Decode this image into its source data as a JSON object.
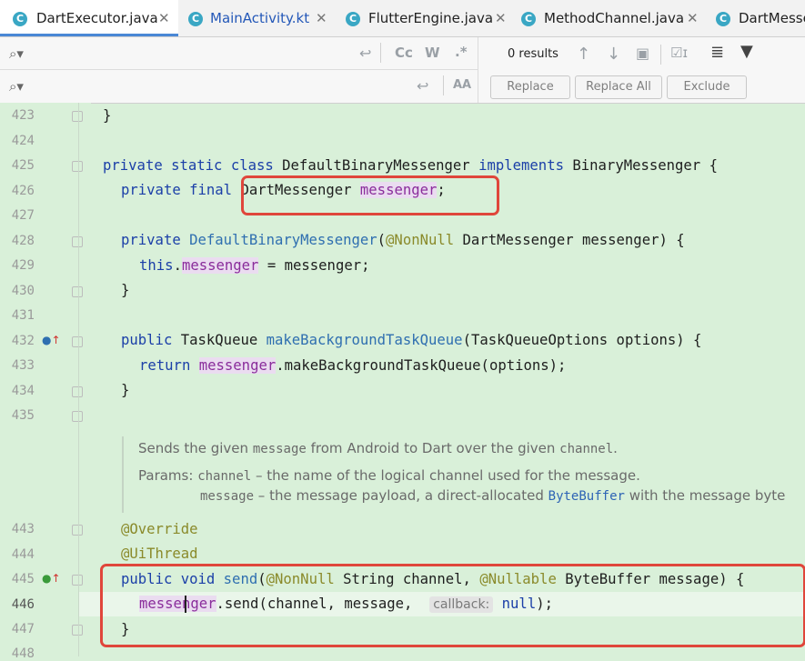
{
  "tabs": [
    {
      "label": "DartExecutor.java",
      "icon": "C",
      "active": true
    },
    {
      "label": "MainActivity.kt",
      "icon": "C",
      "active": false
    },
    {
      "label": "FlutterEngine.java",
      "icon": "C",
      "active": false
    },
    {
      "label": "MethodChannel.java",
      "icon": "C",
      "active": false
    },
    {
      "label": "DartMesse",
      "icon": "C",
      "active": false
    }
  ],
  "find": {
    "results": "0 results",
    "match_case": "Cc",
    "words": "W",
    "regex": ".*",
    "preserve_case": "AA",
    "replace": "Replace",
    "replace_all": "Replace All",
    "exclude": "Exclude"
  },
  "lines": {
    "n423": "423",
    "n424": "424",
    "n425": "425",
    "n426": "426",
    "n427": "427",
    "n428": "428",
    "n429": "429",
    "n430": "430",
    "n431": "431",
    "n432": "432",
    "n433": "433",
    "n434": "434",
    "n435": "435",
    "n443": "443",
    "n444": "444",
    "n445": "445",
    "n446": "446",
    "n447": "447",
    "n448": "448"
  },
  "code": {
    "l423": "}",
    "l425_kw": "private static class",
    "l425_name": "DefaultBinaryMessenger",
    "l425_impl": "implements",
    "l425_iface": "BinaryMessenger {",
    "l426_kw": "private final",
    "l426_type": "DartMessenger",
    "l426_field": "messenger",
    "l426_end": ";",
    "l428_kw": "private",
    "l428_fn": "DefaultBinaryMessenger",
    "l428_paren": "(",
    "l428_ann": "@NonNull",
    "l428_rest": "DartMessenger messenger) {",
    "l429_this": "this",
    "l429_dot": ".",
    "l429_field": "messenger",
    "l429_rest": "= messenger;",
    "l430": "}",
    "l432_kw": "public",
    "l432_type": "TaskQueue",
    "l432_fn": "makeBackgroundTaskQueue",
    "l432_rest": "(TaskQueueOptions options) {",
    "l433_kw": "return",
    "l433_field": "messenger",
    "l433_rest": ".makeBackgroundTaskQueue(options);",
    "l434": "}",
    "l443": "@Override",
    "l444": "@UiThread",
    "l445_kw": "public void",
    "l445_fn": "send",
    "l445_p": "(",
    "l445_ann1": "@NonNull",
    "l445_mid": "String channel,",
    "l445_ann2": "@Nullable",
    "l445_rest": "ByteBuffer message) {",
    "l446_field": "messenger",
    "l446_rest": ".send(channel, message,",
    "l446_hint": "callback:",
    "l446_null": "null",
    "l446_end": ");",
    "l447": "}"
  },
  "doc": {
    "line1_a": "Sends the given",
    "line1_code1": "message",
    "line1_b": "from Android to Dart over the given",
    "line1_code2": "channel",
    "line1_c": ".",
    "params_label": "Params:",
    "p1_code": "channel",
    "p1_text": "– the name of the logical channel used for the message.",
    "p2_code": "message",
    "p2_text": "– the message payload, a direct-allocated",
    "p2_link": "ByteBuffer",
    "p2_end": "with the message byte"
  }
}
